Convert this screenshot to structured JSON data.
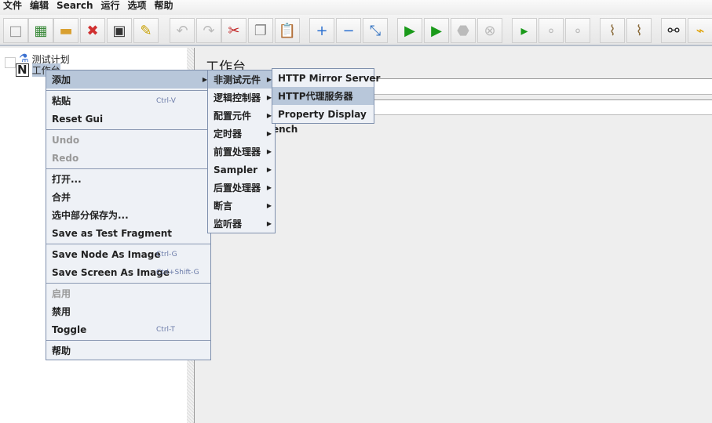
{
  "menubar": [
    "文件",
    "编辑",
    "Search",
    "运行",
    "选项",
    "帮助"
  ],
  "toolbar": [
    {
      "icon": "new-icon",
      "g": "□",
      "c": "#999"
    },
    {
      "icon": "templates-icon",
      "g": "▦",
      "c": "#3a8a3a"
    },
    {
      "icon": "open-icon",
      "g": "▬",
      "c": "#d9a030"
    },
    {
      "icon": "close-icon",
      "g": "✖",
      "c": "#d03030"
    },
    {
      "icon": "save-icon",
      "g": "▣",
      "c": "#333"
    },
    {
      "icon": "save-as-icon",
      "g": "✎",
      "c": "#c8a000"
    },
    {
      "icon": "undo-icon",
      "g": "↶",
      "c": "#bbb",
      "d": true
    },
    {
      "icon": "redo-icon",
      "g": "↷",
      "c": "#bbb",
      "d": true
    },
    {
      "icon": "cut-icon",
      "g": "✂",
      "c": "#c02020"
    },
    {
      "icon": "copy-icon",
      "g": "❐",
      "c": "#888"
    },
    {
      "icon": "paste-icon",
      "g": "📋",
      "c": "#a07030"
    },
    {
      "icon": "expand-icon",
      "g": "+",
      "c": "#2a6fd0"
    },
    {
      "icon": "collapse-icon",
      "g": "−",
      "c": "#2a6fd0"
    },
    {
      "icon": "toggle-icon",
      "g": "⤡",
      "c": "#3070c0"
    },
    {
      "icon": "start-icon",
      "g": "▶",
      "c": "#1a9a1a"
    },
    {
      "icon": "start-no-pause-icon",
      "g": "▶",
      "c": "#1a9a1a"
    },
    {
      "icon": "stop-icon",
      "g": "⬣",
      "c": "#bbb",
      "d": true
    },
    {
      "icon": "shutdown-icon",
      "g": "⊗",
      "c": "#bbb",
      "d": true
    },
    {
      "icon": "remote-start-icon",
      "g": "▸",
      "c": "#1a9a1a"
    },
    {
      "icon": "remote-stop-icon",
      "g": "∘",
      "c": "#bbb",
      "d": true
    },
    {
      "icon": "remote-shutdown-icon",
      "g": "∘",
      "c": "#bbb",
      "d": true
    },
    {
      "icon": "clear-icon",
      "g": "⌇",
      "c": "#8a6a3a"
    },
    {
      "icon": "clear-all-icon",
      "g": "⌇",
      "c": "#8a6a3a"
    },
    {
      "icon": "search-icon",
      "g": "⚯",
      "c": "#222"
    },
    {
      "icon": "reset-search-icon",
      "g": "⌁",
      "c": "#e0a000"
    }
  ],
  "tree": {
    "items": [
      "测试计划",
      "工作台"
    ]
  },
  "main": {
    "title": "工作台",
    "partial_text": "ench"
  },
  "context_menu": {
    "groups": [
      [
        {
          "label": "添加",
          "submenu": true,
          "selected": true
        }
      ],
      [
        {
          "label": "粘贴",
          "shortcut": "Ctrl-V"
        },
        {
          "label": "Reset Gui"
        }
      ],
      [
        {
          "label": "Undo",
          "disabled": true
        },
        {
          "label": "Redo",
          "disabled": true
        }
      ],
      [
        {
          "label": "打开..."
        },
        {
          "label": "合并"
        },
        {
          "label": "选中部分保存为..."
        },
        {
          "label": "Save as Test Fragment"
        }
      ],
      [
        {
          "label": "Save Node As Image",
          "shortcut": "Ctrl-G"
        },
        {
          "label": "Save Screen As Image",
          "shortcut": "Ctrl+Shift-G"
        }
      ],
      [
        {
          "label": "启用",
          "disabled": true
        },
        {
          "label": "禁用"
        },
        {
          "label": "Toggle",
          "shortcut": "Ctrl-T"
        }
      ],
      [
        {
          "label": "帮助"
        }
      ]
    ]
  },
  "add_submenu": [
    {
      "label": "非测试元件",
      "selected": true
    },
    {
      "label": "逻辑控制器"
    },
    {
      "label": "配置元件"
    },
    {
      "label": "定时器"
    },
    {
      "label": "前置处理器"
    },
    {
      "label": "Sampler"
    },
    {
      "label": "后置处理器"
    },
    {
      "label": "断言"
    },
    {
      "label": "监听器"
    }
  ],
  "non_test_submenu": [
    {
      "label": "HTTP Mirror Server"
    },
    {
      "label": "HTTP代理服务器",
      "selected": true
    },
    {
      "label": "Property Display"
    }
  ]
}
